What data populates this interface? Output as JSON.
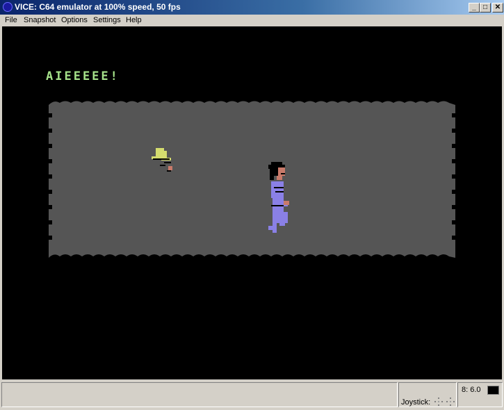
{
  "window": {
    "title": "VICE: C64 emulator at 100% speed, 50 fps",
    "app_icon": "vice-c64-icon",
    "controls": {
      "minimize": "_",
      "maximize": "□",
      "close": "✕"
    }
  },
  "menu": {
    "items": [
      {
        "label": "File",
        "accel": "F"
      },
      {
        "label": "Snapshot",
        "accel": "p"
      },
      {
        "label": "Options",
        "accel": "O"
      },
      {
        "label": "Settings",
        "accel": "t"
      },
      {
        "label": "Help",
        "accel": "H"
      }
    ]
  },
  "game": {
    "message": "AIEEEEE!",
    "colors": {
      "background": "#000000",
      "playfield": "#555555",
      "text": "#a6e28a",
      "hat": "#d4dc6e",
      "shirt": "#8a80e6",
      "skin": "#c87a6a",
      "hair": "#000000"
    }
  },
  "status": {
    "joystick_label": "Joystick:",
    "drive_label": "8: 6.0",
    "drive_led_color": "#000000"
  }
}
